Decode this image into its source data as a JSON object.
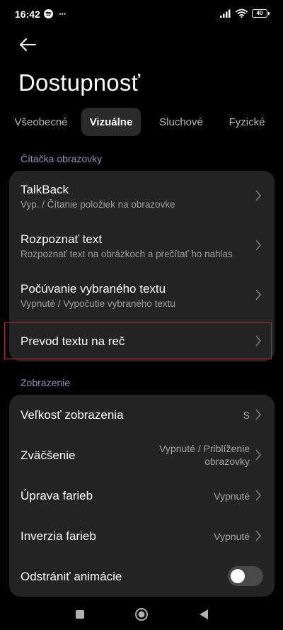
{
  "status_bar": {
    "time": "16:42",
    "dots": "···",
    "battery": "40"
  },
  "page": {
    "title": "Dostupnosť"
  },
  "tabs": [
    {
      "label": "Všeobecné",
      "active": false
    },
    {
      "label": "Vizuálne",
      "active": true
    },
    {
      "label": "Sluchové",
      "active": false
    },
    {
      "label": "Fyzické",
      "active": false
    }
  ],
  "sections": {
    "screen_reader": {
      "header": "Čítačka obrazovky",
      "items": [
        {
          "title": "TalkBack",
          "subtitle": "Vyp. / Čítanie položiek na obrazovke"
        },
        {
          "title": "Rozpoznať text",
          "subtitle": "Rozpoznať text na obrázkoch a prečítať ho nahlas"
        },
        {
          "title": "Počúvanie vybraného textu",
          "subtitle": "Vypnuté / Vypočutie vybraného textu"
        },
        {
          "title": "Prevod textu na reč"
        }
      ]
    },
    "display": {
      "header": "Zobrazenie",
      "items": [
        {
          "title": "Veľkosť zobrazenia",
          "value": "S"
        },
        {
          "title": "Zväčšenie",
          "value_line1": "Vypnuté / Priblíženie",
          "value_line2": "obrazovky"
        },
        {
          "title": "Úprava farieb",
          "value": "Vypnuté"
        },
        {
          "title": "Inverzia farieb",
          "value": "Vypnuté"
        },
        {
          "title": "Odstrániť animácie",
          "toggle_on": false
        }
      ]
    }
  },
  "colors": {
    "background": "#000000",
    "card": "#242424",
    "section_header": "#8b93b8",
    "highlight": "#c0262e"
  }
}
